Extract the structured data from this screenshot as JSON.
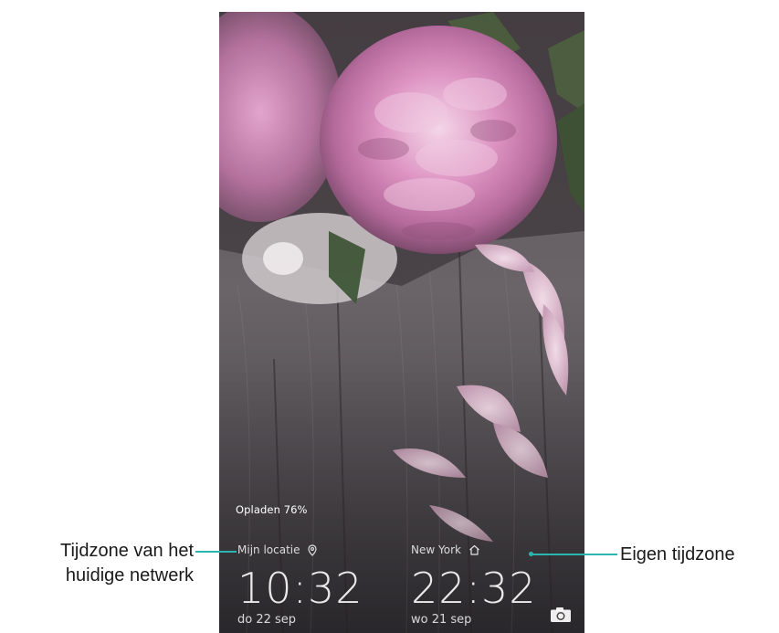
{
  "lockscreen": {
    "charging_status": "Opladen 76%",
    "clocks": [
      {
        "city": "Mijn locatie",
        "icon": "location-pin-icon",
        "time": "10:32",
        "date": "do 22 sep"
      },
      {
        "city": "New York",
        "icon": "home-icon",
        "time": "22:32",
        "date": "wo 21 sep"
      }
    ],
    "camera_shortcut_icon": "camera-icon"
  },
  "callouts": {
    "left": {
      "line1": "Tijdzone van het",
      "line2": "huidige netwerk"
    },
    "right": {
      "text": "Eigen tijdzone"
    },
    "leader_color": "#2bb5b1"
  }
}
